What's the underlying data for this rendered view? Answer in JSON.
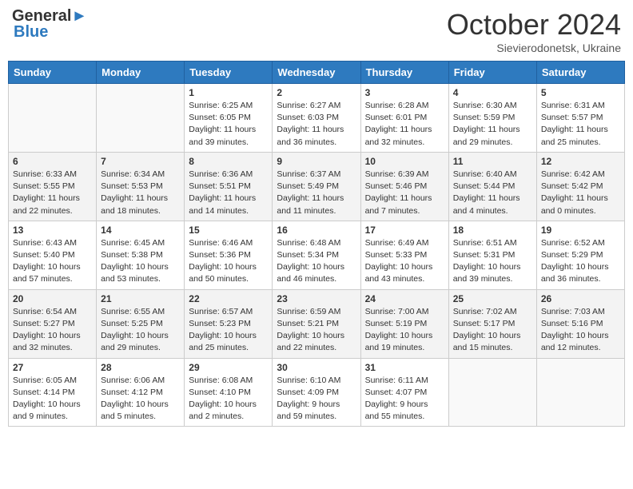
{
  "header": {
    "logo_line1": "General",
    "logo_line2": "Blue",
    "month": "October 2024",
    "location": "Sievierodonetsk, Ukraine"
  },
  "weekdays": [
    "Sunday",
    "Monday",
    "Tuesday",
    "Wednesday",
    "Thursday",
    "Friday",
    "Saturday"
  ],
  "weeks": [
    [
      {
        "day": "",
        "info": ""
      },
      {
        "day": "",
        "info": ""
      },
      {
        "day": "1",
        "info": "Sunrise: 6:25 AM\nSunset: 6:05 PM\nDaylight: 11 hours and 39 minutes."
      },
      {
        "day": "2",
        "info": "Sunrise: 6:27 AM\nSunset: 6:03 PM\nDaylight: 11 hours and 36 minutes."
      },
      {
        "day": "3",
        "info": "Sunrise: 6:28 AM\nSunset: 6:01 PM\nDaylight: 11 hours and 32 minutes."
      },
      {
        "day": "4",
        "info": "Sunrise: 6:30 AM\nSunset: 5:59 PM\nDaylight: 11 hours and 29 minutes."
      },
      {
        "day": "5",
        "info": "Sunrise: 6:31 AM\nSunset: 5:57 PM\nDaylight: 11 hours and 25 minutes."
      }
    ],
    [
      {
        "day": "6",
        "info": "Sunrise: 6:33 AM\nSunset: 5:55 PM\nDaylight: 11 hours and 22 minutes."
      },
      {
        "day": "7",
        "info": "Sunrise: 6:34 AM\nSunset: 5:53 PM\nDaylight: 11 hours and 18 minutes."
      },
      {
        "day": "8",
        "info": "Sunrise: 6:36 AM\nSunset: 5:51 PM\nDaylight: 11 hours and 14 minutes."
      },
      {
        "day": "9",
        "info": "Sunrise: 6:37 AM\nSunset: 5:49 PM\nDaylight: 11 hours and 11 minutes."
      },
      {
        "day": "10",
        "info": "Sunrise: 6:39 AM\nSunset: 5:46 PM\nDaylight: 11 hours and 7 minutes."
      },
      {
        "day": "11",
        "info": "Sunrise: 6:40 AM\nSunset: 5:44 PM\nDaylight: 11 hours and 4 minutes."
      },
      {
        "day": "12",
        "info": "Sunrise: 6:42 AM\nSunset: 5:42 PM\nDaylight: 11 hours and 0 minutes."
      }
    ],
    [
      {
        "day": "13",
        "info": "Sunrise: 6:43 AM\nSunset: 5:40 PM\nDaylight: 10 hours and 57 minutes."
      },
      {
        "day": "14",
        "info": "Sunrise: 6:45 AM\nSunset: 5:38 PM\nDaylight: 10 hours and 53 minutes."
      },
      {
        "day": "15",
        "info": "Sunrise: 6:46 AM\nSunset: 5:36 PM\nDaylight: 10 hours and 50 minutes."
      },
      {
        "day": "16",
        "info": "Sunrise: 6:48 AM\nSunset: 5:34 PM\nDaylight: 10 hours and 46 minutes."
      },
      {
        "day": "17",
        "info": "Sunrise: 6:49 AM\nSunset: 5:33 PM\nDaylight: 10 hours and 43 minutes."
      },
      {
        "day": "18",
        "info": "Sunrise: 6:51 AM\nSunset: 5:31 PM\nDaylight: 10 hours and 39 minutes."
      },
      {
        "day": "19",
        "info": "Sunrise: 6:52 AM\nSunset: 5:29 PM\nDaylight: 10 hours and 36 minutes."
      }
    ],
    [
      {
        "day": "20",
        "info": "Sunrise: 6:54 AM\nSunset: 5:27 PM\nDaylight: 10 hours and 32 minutes."
      },
      {
        "day": "21",
        "info": "Sunrise: 6:55 AM\nSunset: 5:25 PM\nDaylight: 10 hours and 29 minutes."
      },
      {
        "day": "22",
        "info": "Sunrise: 6:57 AM\nSunset: 5:23 PM\nDaylight: 10 hours and 25 minutes."
      },
      {
        "day": "23",
        "info": "Sunrise: 6:59 AM\nSunset: 5:21 PM\nDaylight: 10 hours and 22 minutes."
      },
      {
        "day": "24",
        "info": "Sunrise: 7:00 AM\nSunset: 5:19 PM\nDaylight: 10 hours and 19 minutes."
      },
      {
        "day": "25",
        "info": "Sunrise: 7:02 AM\nSunset: 5:17 PM\nDaylight: 10 hours and 15 minutes."
      },
      {
        "day": "26",
        "info": "Sunrise: 7:03 AM\nSunset: 5:16 PM\nDaylight: 10 hours and 12 minutes."
      }
    ],
    [
      {
        "day": "27",
        "info": "Sunrise: 6:05 AM\nSunset: 4:14 PM\nDaylight: 10 hours and 9 minutes."
      },
      {
        "day": "28",
        "info": "Sunrise: 6:06 AM\nSunset: 4:12 PM\nDaylight: 10 hours and 5 minutes."
      },
      {
        "day": "29",
        "info": "Sunrise: 6:08 AM\nSunset: 4:10 PM\nDaylight: 10 hours and 2 minutes."
      },
      {
        "day": "30",
        "info": "Sunrise: 6:10 AM\nSunset: 4:09 PM\nDaylight: 9 hours and 59 minutes."
      },
      {
        "day": "31",
        "info": "Sunrise: 6:11 AM\nSunset: 4:07 PM\nDaylight: 9 hours and 55 minutes."
      },
      {
        "day": "",
        "info": ""
      },
      {
        "day": "",
        "info": ""
      }
    ]
  ]
}
